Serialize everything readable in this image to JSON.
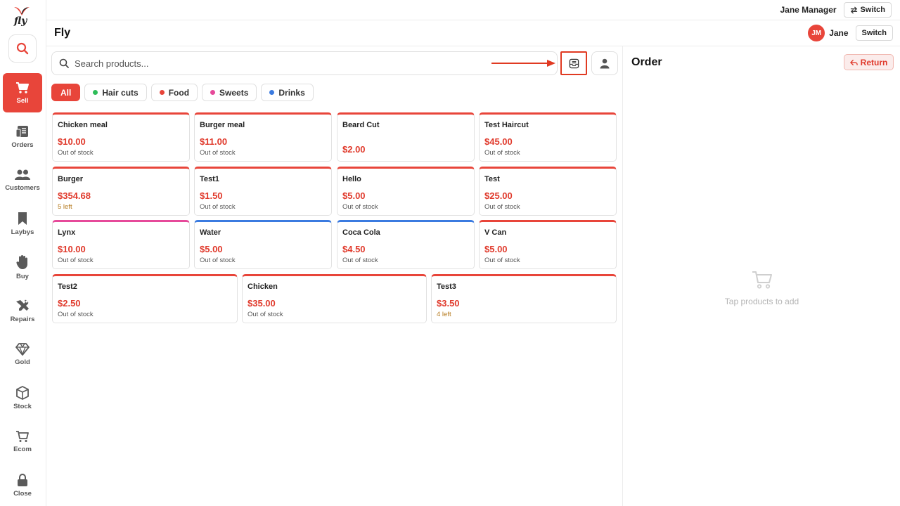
{
  "topbar": {
    "user_name": "Jane Manager",
    "switch_label": "Switch"
  },
  "logo": {
    "text": "fly",
    "icon": "bird-logo-icon"
  },
  "nav": {
    "items": [
      {
        "label": "Sell",
        "icon": "cart-icon",
        "active": true
      },
      {
        "label": "Orders",
        "icon": "receipt-icon"
      },
      {
        "label": "Customers",
        "icon": "users-icon"
      },
      {
        "label": "Laybys",
        "icon": "bookmark-icon"
      },
      {
        "label": "Buy",
        "icon": "hand-icon"
      },
      {
        "label": "Repairs",
        "icon": "tools-icon"
      },
      {
        "label": "Gold",
        "icon": "diamond-icon"
      },
      {
        "label": "Stock",
        "icon": "box-icon"
      },
      {
        "label": "Ecom",
        "icon": "shopping-cart-icon"
      },
      {
        "label": "Close",
        "icon": "lock-icon"
      }
    ]
  },
  "header": {
    "title": "Fly",
    "avatar_initials": "JM",
    "user_short_name": "Jane",
    "switch_label": "Switch"
  },
  "search": {
    "placeholder": "Search products..."
  },
  "filters": [
    {
      "label": "All",
      "active": true
    },
    {
      "label": "Hair cuts",
      "color": "#2ebd59"
    },
    {
      "label": "Food",
      "color": "#e8453a"
    },
    {
      "label": "Sweets",
      "color": "#e64a9a"
    },
    {
      "label": "Drinks",
      "color": "#3b7be0"
    }
  ],
  "products": [
    {
      "name": "Chicken meal",
      "price": "$10.00",
      "stock": "Out of stock",
      "color": "#e8453a"
    },
    {
      "name": "Burger meal",
      "price": "$11.00",
      "stock": "Out of stock",
      "color": "#e8453a"
    },
    {
      "name": "Beard Cut",
      "price": "$2.00",
      "stock": "",
      "color": "#e8453a"
    },
    {
      "name": "Test Haircut",
      "price": "$45.00",
      "stock": "Out of stock",
      "color": "#e8453a"
    },
    {
      "name": "Burger",
      "price": "$354.68",
      "stock": "5 left",
      "color": "#e8453a"
    },
    {
      "name": "Test1",
      "price": "$1.50",
      "stock": "Out of stock",
      "color": "#e8453a"
    },
    {
      "name": "Hello",
      "price": "$5.00",
      "stock": "Out of stock",
      "color": "#e8453a"
    },
    {
      "name": "Test",
      "price": "$25.00",
      "stock": "Out of stock",
      "color": "#e8453a"
    },
    {
      "name": "Lynx",
      "price": "$10.00",
      "stock": "Out of stock",
      "color": "#e64a9a"
    },
    {
      "name": "Water",
      "price": "$5.00",
      "stock": "Out of stock",
      "color": "#3b7be0"
    },
    {
      "name": "Coca Cola",
      "price": "$4.50",
      "stock": "Out of stock",
      "color": "#3b7be0"
    },
    {
      "name": "V Can",
      "price": "$5.00",
      "stock": "Out of stock",
      "color": "#e8453a"
    },
    {
      "name": "Test2",
      "price": "$2.50",
      "stock": "Out of stock",
      "color": "#e8453a"
    },
    {
      "name": "Chicken",
      "price": "$35.00",
      "stock": "Out of stock",
      "color": "#e8453a"
    },
    {
      "name": "Test3",
      "price": "$3.50",
      "stock": "4 left",
      "color": "#e8453a"
    }
  ],
  "order": {
    "title": "Order",
    "return_label": "Return",
    "empty_text": "Tap products to add"
  },
  "colors": {
    "accent": "#e8453a",
    "annotation": "#e03a22"
  }
}
